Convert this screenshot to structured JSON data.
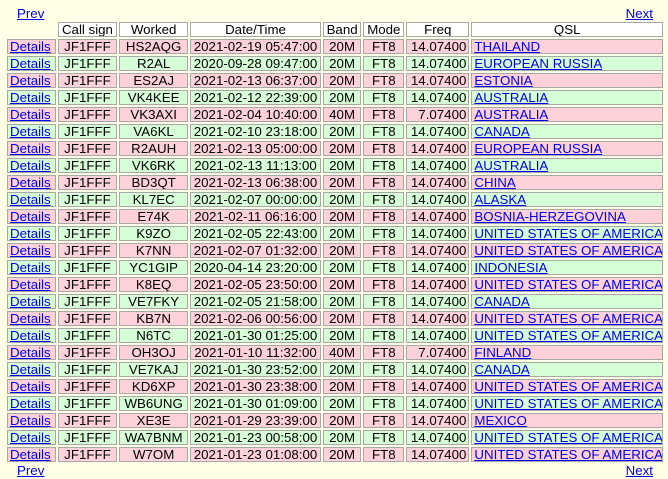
{
  "nav": {
    "prev": "Prev",
    "next": "Next"
  },
  "columns": [
    "",
    "Call sign",
    "Worked",
    "Date/Time",
    "Band",
    "Mode",
    "Freq",
    "QSL"
  ],
  "details_label": "Details",
  "colors": {
    "pink_row": "#ffd1d9",
    "green_row": "#d7ffd7",
    "background": "#ffffe7",
    "link": "#0000ee"
  },
  "rows": [
    {
      "status": "pink",
      "call": "JF1FFF",
      "worked": "HS2AQG",
      "datetime": "2021-02-19 05:47:00",
      "band": "20M",
      "mode": "FT8",
      "freq": "14.07400",
      "qsl": "THAILAND"
    },
    {
      "status": "green",
      "call": "JF1FFF",
      "worked": "R2AL",
      "datetime": "2020-09-28 09:47:00",
      "band": "20M",
      "mode": "FT8",
      "freq": "14.07400",
      "qsl": "EUROPEAN RUSSIA"
    },
    {
      "status": "pink",
      "call": "JF1FFF",
      "worked": "ES2AJ",
      "datetime": "2021-02-13 06:37:00",
      "band": "20M",
      "mode": "FT8",
      "freq": "14.07400",
      "qsl": "ESTONIA"
    },
    {
      "status": "green",
      "call": "JF1FFF",
      "worked": "VK4KEE",
      "datetime": "2021-02-12 22:39:00",
      "band": "20M",
      "mode": "FT8",
      "freq": "14.07400",
      "qsl": "AUSTRALIA"
    },
    {
      "status": "pink",
      "call": "JF1FFF",
      "worked": "VK3AXI",
      "datetime": "2021-02-04 10:40:00",
      "band": "40M",
      "mode": "FT8",
      "freq": "7.07400",
      "qsl": "AUSTRALIA"
    },
    {
      "status": "green",
      "call": "JF1FFF",
      "worked": "VA6KL",
      "datetime": "2021-02-10 23:18:00",
      "band": "20M",
      "mode": "FT8",
      "freq": "14.07400",
      "qsl": "CANADA"
    },
    {
      "status": "pink",
      "call": "JF1FFF",
      "worked": "R2AUH",
      "datetime": "2021-02-13 05:00:00",
      "band": "20M",
      "mode": "FT8",
      "freq": "14.07400",
      "qsl": "EUROPEAN RUSSIA"
    },
    {
      "status": "green",
      "call": "JF1FFF",
      "worked": "VK6RK",
      "datetime": "2021-02-13 11:13:00",
      "band": "20M",
      "mode": "FT8",
      "freq": "14.07400",
      "qsl": "AUSTRALIA"
    },
    {
      "status": "pink",
      "call": "JF1FFF",
      "worked": "BD3QT",
      "datetime": "2021-02-13 06:38:00",
      "band": "20M",
      "mode": "FT8",
      "freq": "14.07400",
      "qsl": "CHINA"
    },
    {
      "status": "green",
      "call": "JF1FFF",
      "worked": "KL7EC",
      "datetime": "2021-02-07 00:00:00",
      "band": "20M",
      "mode": "FT8",
      "freq": "14.07400",
      "qsl": "ALASKA"
    },
    {
      "status": "pink",
      "call": "JF1FFF",
      "worked": "E74K",
      "datetime": "2021-02-11 06:16:00",
      "band": "20M",
      "mode": "FT8",
      "freq": "14.07400",
      "qsl": "BOSNIA-HERZEGOVINA"
    },
    {
      "status": "green",
      "call": "JF1FFF",
      "worked": "K9ZO",
      "datetime": "2021-02-05 22:43:00",
      "band": "20M",
      "mode": "FT8",
      "freq": "14.07400",
      "qsl": "UNITED STATES OF AMERICA"
    },
    {
      "status": "pink",
      "call": "JF1FFF",
      "worked": "K7NN",
      "datetime": "2021-02-07 01:32:00",
      "band": "20M",
      "mode": "FT8",
      "freq": "14.07400",
      "qsl": "UNITED STATES OF AMERICA"
    },
    {
      "status": "green",
      "call": "JF1FFF",
      "worked": "YC1GIP",
      "datetime": "2020-04-14 23:20:00",
      "band": "20M",
      "mode": "FT8",
      "freq": "14.07400",
      "qsl": "INDONESIA"
    },
    {
      "status": "pink",
      "call": "JF1FFF",
      "worked": "K8EQ",
      "datetime": "2021-02-05 23:50:00",
      "band": "20M",
      "mode": "FT8",
      "freq": "14.07400",
      "qsl": "UNITED STATES OF AMERICA"
    },
    {
      "status": "green",
      "call": "JF1FFF",
      "worked": "VE7FKY",
      "datetime": "2021-02-05 21:58:00",
      "band": "20M",
      "mode": "FT8",
      "freq": "14.07400",
      "qsl": "CANADA"
    },
    {
      "status": "pink",
      "call": "JF1FFF",
      "worked": "KB7N",
      "datetime": "2021-02-06 00:56:00",
      "band": "20M",
      "mode": "FT8",
      "freq": "14.07400",
      "qsl": "UNITED STATES OF AMERICA"
    },
    {
      "status": "green",
      "call": "JF1FFF",
      "worked": "N6TC",
      "datetime": "2021-01-30 01:25:00",
      "band": "20M",
      "mode": "FT8",
      "freq": "14.07400",
      "qsl": "UNITED STATES OF AMERICA"
    },
    {
      "status": "pink",
      "call": "JF1FFF",
      "worked": "OH3OJ",
      "datetime": "2021-01-10 11:32:00",
      "band": "40M",
      "mode": "FT8",
      "freq": "7.07400",
      "qsl": "FINLAND"
    },
    {
      "status": "green",
      "call": "JF1FFF",
      "worked": "VE7KAJ",
      "datetime": "2021-01-30 23:52:00",
      "band": "20M",
      "mode": "FT8",
      "freq": "14.07400",
      "qsl": "CANADA"
    },
    {
      "status": "pink",
      "call": "JF1FFF",
      "worked": "KD6XP",
      "datetime": "2021-01-30 23:38:00",
      "band": "20M",
      "mode": "FT8",
      "freq": "14.07400",
      "qsl": "UNITED STATES OF AMERICA"
    },
    {
      "status": "green",
      "call": "JF1FFF",
      "worked": "WB6UNG",
      "datetime": "2021-01-30 01:09:00",
      "band": "20M",
      "mode": "FT8",
      "freq": "14.07400",
      "qsl": "UNITED STATES OF AMERICA"
    },
    {
      "status": "pink",
      "call": "JF1FFF",
      "worked": "XE3E",
      "datetime": "2021-01-29 23:39:00",
      "band": "20M",
      "mode": "FT8",
      "freq": "14.07400",
      "qsl": "MEXICO"
    },
    {
      "status": "green",
      "call": "JF1FFF",
      "worked": "WA7BNM",
      "datetime": "2021-01-23 00:58:00",
      "band": "20M",
      "mode": "FT8",
      "freq": "14.07400",
      "qsl": "UNITED STATES OF AMERICA"
    },
    {
      "status": "pink",
      "call": "JF1FFF",
      "worked": "W7OM",
      "datetime": "2021-01-23 01:08:00",
      "band": "20M",
      "mode": "FT8",
      "freq": "14.07400",
      "qsl": "UNITED STATES OF AMERICA"
    }
  ]
}
